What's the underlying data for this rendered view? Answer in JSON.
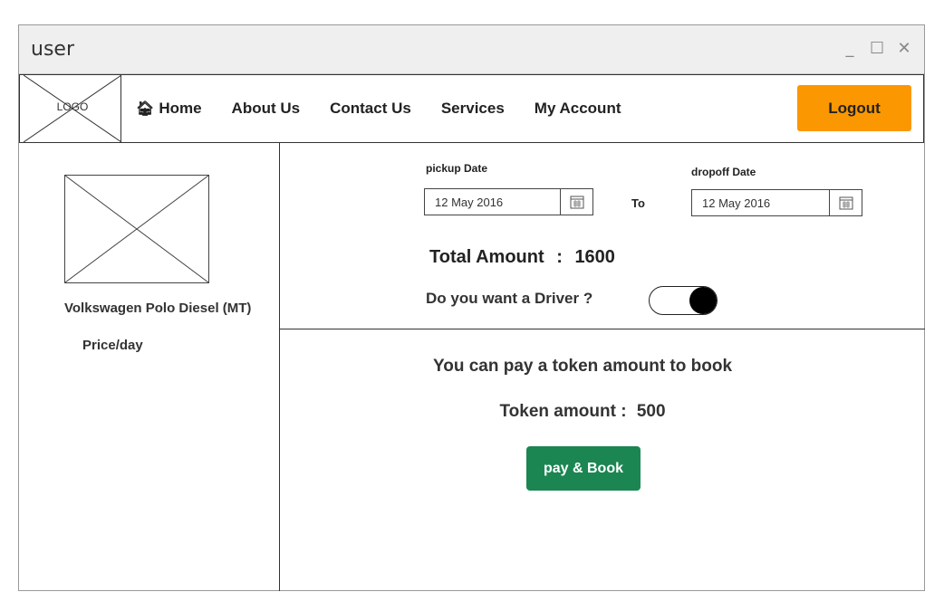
{
  "window": {
    "title": "user",
    "controls": {
      "minimize": "_",
      "maximize": "☐",
      "close": "✕"
    }
  },
  "navbar": {
    "logo_text": "LOGO",
    "items": [
      {
        "label": "Home",
        "icon": "home-icon"
      },
      {
        "label": "About Us"
      },
      {
        "label": "Contact Us"
      },
      {
        "label": "Services"
      },
      {
        "label": "My Account"
      }
    ],
    "logout_label": "Logout",
    "accent_color": "#fb9700"
  },
  "sidebar": {
    "car_name": "Volkswagen Polo Diesel (MT)",
    "price_label": "Price/day"
  },
  "booking": {
    "pickup_label": "pickup Date",
    "pickup_value": "12 May 2016",
    "to_label": "To",
    "dropoff_label": "dropoff Date",
    "dropoff_value": "12 May 2016",
    "total_label": "Total Amount",
    "total_sep": ":",
    "total_value": "1600",
    "driver_question": "Do you want a Driver ?",
    "driver_toggle_on": true
  },
  "token": {
    "message": "You can pay a token amount to book",
    "amount_label": "Token amount :",
    "amount_value": "500",
    "pay_label": "pay & Book",
    "pay_color": "#1b8652"
  }
}
